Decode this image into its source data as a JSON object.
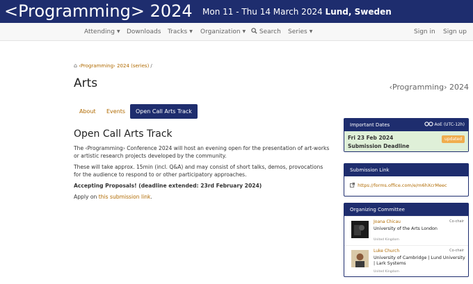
{
  "header": {
    "brand": "<Programming> 2024",
    "dates": "Mon 11 - Thu 14 March 2024",
    "location": "Lund, Sweden"
  },
  "nav": {
    "attending": "Attending",
    "downloads": "Downloads",
    "tracks": "Tracks",
    "organization": "Organization",
    "search": "Search",
    "series": "Series",
    "sign_in": "Sign in",
    "sign_up": "Sign up"
  },
  "breadcrumb": {
    "link": "‹Programming› 2024 (series)",
    "separator": "/"
  },
  "page": {
    "title": "Arts",
    "series_label": "‹Programming› 2024"
  },
  "tabs": {
    "about": "About",
    "events": "Events",
    "open_call": "Open Call Arts Track"
  },
  "content": {
    "heading": "Open Call Arts Track",
    "para1": "The ‹Programming› Conference 2024 will host an evening open for the presentation of art-works or artistic research projects developed by the community.",
    "para2": "These will take approx. 15min (incl. Q&A) and may consist of short talks, demos, provocations for the audience to respond to or other participatory approaches.",
    "accepting": "Accepting Proposals! (deadline extended: 23rd February 2024)",
    "apply_prefix": "Apply on",
    "apply_link": "this submission link",
    "apply_suffix": "."
  },
  "sidebar": {
    "important_dates": {
      "title": "Important Dates",
      "timezone": "AoE (UTC-12h)",
      "date": "Fri 23 Feb 2024",
      "label": "Submission Deadline",
      "badge": "updated"
    },
    "submission_link": {
      "title": "Submission Link",
      "url": "https://forms.office.com/e/m6hXcrMeec"
    },
    "committee": {
      "title": "Organizing Committee",
      "members": [
        {
          "name": "Joana Chicau",
          "role": "Co-chair",
          "affiliation": "University of the Arts London",
          "country": "United Kingdom"
        },
        {
          "name": "Luke Church",
          "role": "Co-chair",
          "affiliation": "University of Cambridge | Lund University | Lark Systems",
          "country": "United Kingdom"
        }
      ]
    }
  },
  "colors": {
    "primary": "#1e2d6e",
    "link": "#b06a00",
    "date_bg": "#dff0d8",
    "badge": "#f0ad4e"
  },
  "icons": {
    "home": "home-icon",
    "search": "search-icon",
    "external_link": "external-link-icon",
    "timezone": "glasses-icon"
  }
}
